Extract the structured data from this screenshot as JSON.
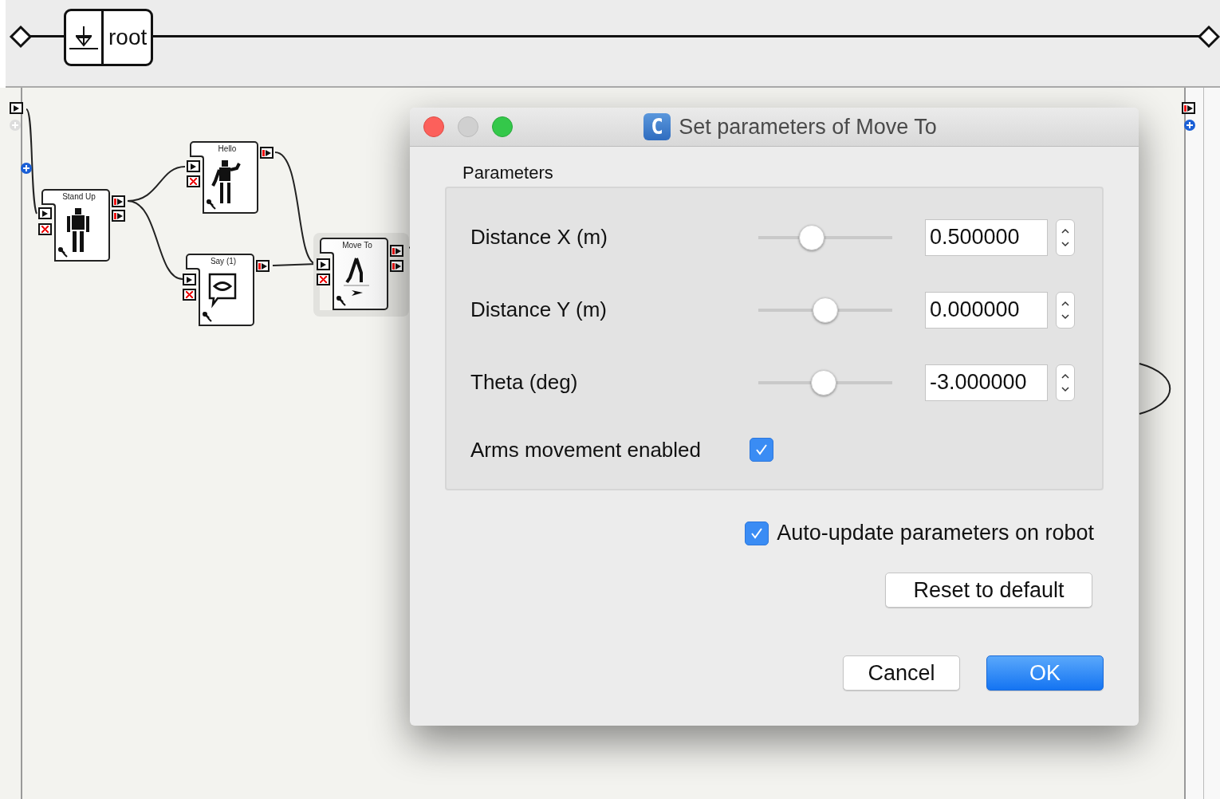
{
  "breadcrumb": {
    "label": "root"
  },
  "nodes": [
    {
      "title": "Stand Up",
      "selected": false
    },
    {
      "title": "Hello",
      "selected": false
    },
    {
      "title": "Say (1)",
      "selected": false
    },
    {
      "title": "Move To",
      "selected": true
    }
  ],
  "dialog": {
    "app_icon": "C",
    "title": "Set parameters of Move To",
    "group_title": "Parameters",
    "params": [
      {
        "kind": "slider",
        "label": "Distance X (m)",
        "level": 0.4,
        "value": "0.500000"
      },
      {
        "kind": "slider",
        "label": "Distance Y (m)",
        "level": 0.5,
        "value": "0.000000"
      },
      {
        "kind": "slider",
        "label": "Theta (deg)",
        "level": 0.49,
        "value": "-3.000000"
      },
      {
        "kind": "checkbox",
        "label": "Arms movement enabled",
        "checked": true
      }
    ],
    "auto_update": {
      "label": "Auto-update parameters on robot",
      "checked": true
    },
    "reset_button": "Reset to default",
    "buttons": [
      {
        "label": "Cancel",
        "default": false
      },
      {
        "label": "OK",
        "default": true
      }
    ]
  }
}
